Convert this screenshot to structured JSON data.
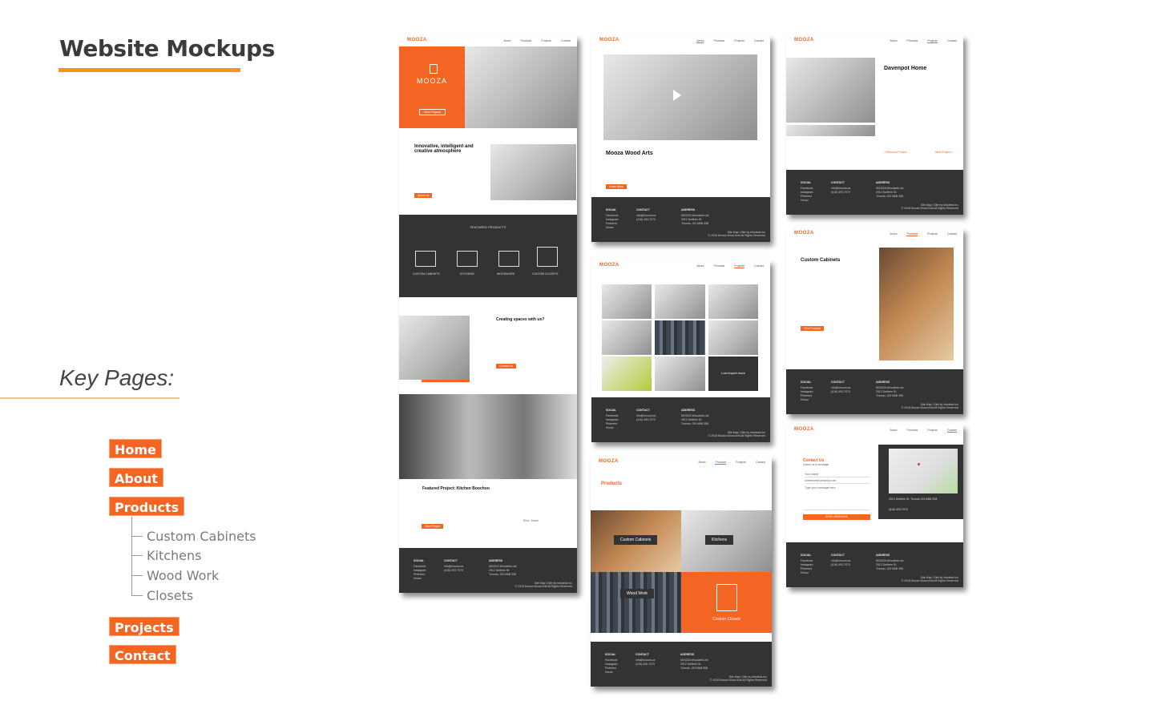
{
  "heading": "Website Mockups",
  "key_pages_label": "Key Pages:",
  "pages": [
    "Home",
    "About",
    "Products",
    "Projects",
    "Contact"
  ],
  "product_subpages": [
    "Custom Cabinets",
    "Kitchens",
    "Wood Work",
    "Closets"
  ],
  "colors": {
    "accent": "#f26522",
    "title_underline": "#f7941d",
    "dark": "#333333"
  },
  "site": {
    "logo": "MOOZA",
    "nav": [
      "About",
      "Products",
      "Projects",
      "Contact"
    ],
    "footer": {
      "social_h": "SOCIAL",
      "social": "Facebook\nInstagram\nPinterest\nHouzz",
      "contact_h": "CONTACT",
      "contact": "info@mooza.ca\n(416) 493-7070",
      "address_h": "ADDRESS",
      "address": "MOOZA Woodarts Ltd.\n2912 Dufferin St.\nToronto, ON M6B 3S8",
      "copy": "Site Map | Site by Infodesk Inc\n© 2018 Mooza Wood Arts All Rights Reserved"
    }
  },
  "home": {
    "hero_logo": "MOOZA",
    "hero_cta": "View Projects",
    "intro_title": "Innovative, intelligent and creative atmosphere",
    "intro_btn": "About Us",
    "featured_title": "FEATURED PRODUCTS",
    "featured_items": [
      "CUSTOM CABINETS",
      "KITCHENS",
      "WOODWORK",
      "CUSTOM CLOSETS"
    ],
    "creating_title": "Creating spaces with us?",
    "creating_btn": "Contact Us",
    "project_title": "Featured Project: Kitchen Boochoo",
    "project_author": "Eliot - Karen",
    "project_btn": "View Project"
  },
  "about": {
    "title": "Mooza Wood Arts",
    "btn": "Learn More"
  },
  "projects_gallery": {
    "tile": "Low import more"
  },
  "project_detail": {
    "title": "Davenpot Home",
    "prev": "« Previous Project",
    "next": "Next Project »"
  },
  "cabinets": {
    "title": "Custom Cabinets",
    "btn": "View Projects"
  },
  "products": {
    "title": "Products",
    "tiles": [
      "Custom Cabinets",
      "Kitchens",
      "Wood Work",
      "Custom Closets"
    ]
  },
  "contact": {
    "title": "Contact Us",
    "sub": "Leave us a message",
    "fields": [
      "Your Name",
      "someone@company.com",
      "Type your message here..."
    ],
    "send": "SEND MESSAGE",
    "address": "2912 Dufferin St. Toronto ON M6B 3S8",
    "phone": "(416) 493-7070"
  }
}
